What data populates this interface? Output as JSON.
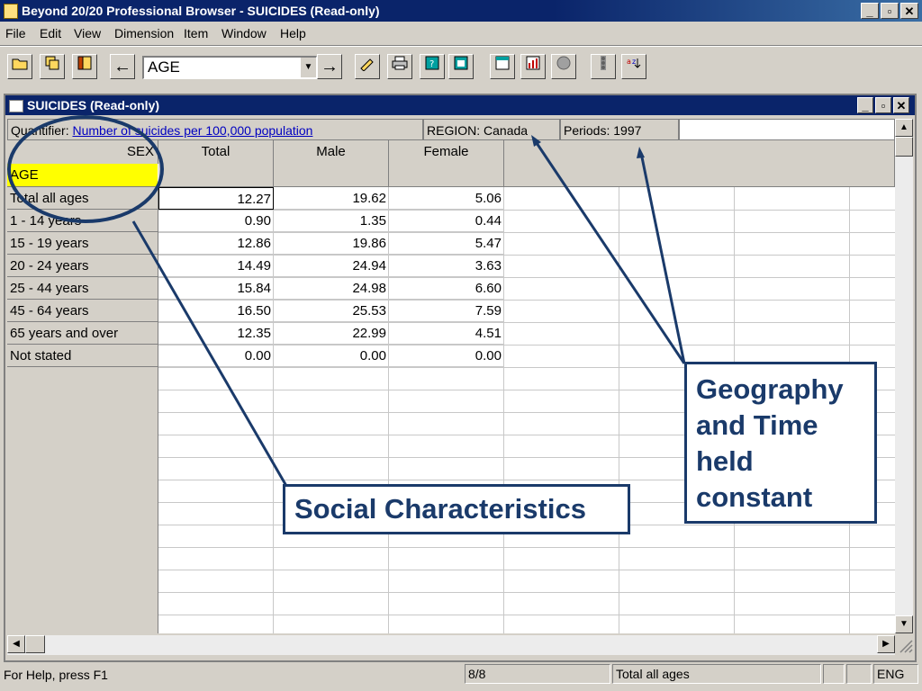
{
  "window": {
    "title": "Beyond 20/20 Professional Browser - SUICIDES (Read-only)",
    "min_glyph": "_",
    "max_glyph": "▫",
    "close_glyph": "✕"
  },
  "menu": [
    "File",
    "Edit",
    "View",
    "Dimension",
    "Item",
    "Window",
    "Help"
  ],
  "toolbar": {
    "back_glyph": "←",
    "forward_glyph": "→",
    "dimension_value": "AGE",
    "dropdown_glyph": "▼",
    "icons": [
      "open-folder-icon",
      "copy-icon",
      "book-icon",
      "pencil-icon",
      "print-icon",
      "help-book-icon",
      "report-icon",
      "table-icon",
      "chart-icon",
      "globe-icon",
      "traffic-light-icon",
      "sort-icon"
    ]
  },
  "document": {
    "title": "SUICIDES (Read-only)",
    "quantifier_label": "Quantifier:",
    "quantifier_value": "Number of suicides per 100,000 population",
    "region": "REGION: Canada",
    "periods": "Periods: 1997"
  },
  "grid": {
    "col_dimension": "SEX",
    "row_dimension": "AGE",
    "columns": [
      "Total",
      "Male",
      "Female"
    ],
    "rows": [
      {
        "label": "Total all ages",
        "values": [
          "12.27",
          "19.62",
          "5.06"
        ]
      },
      {
        "label": "1 - 14 years",
        "values": [
          "0.90",
          "1.35",
          "0.44"
        ]
      },
      {
        "label": "15 - 19 years",
        "values": [
          "12.86",
          "19.86",
          "5.47"
        ]
      },
      {
        "label": "20 - 24 years",
        "values": [
          "14.49",
          "24.94",
          "3.63"
        ]
      },
      {
        "label": "25 - 44 years",
        "values": [
          "15.84",
          "24.98",
          "6.60"
        ]
      },
      {
        "label": "45 - 64 years",
        "values": [
          "16.50",
          "25.53",
          "7.59"
        ]
      },
      {
        "label": "65 years and over",
        "values": [
          "12.35",
          "22.99",
          "4.51"
        ]
      },
      {
        "label": "Not stated",
        "values": [
          "0.00",
          "0.00",
          "0.00"
        ]
      }
    ]
  },
  "status": {
    "help": "For Help, press F1",
    "position": "8/8",
    "current_item": "Total all ages",
    "lang": "ENG"
  },
  "annotations": {
    "social": "Social Characteristics",
    "geo_time": "Geography and Time held constant"
  },
  "colors": {
    "title_bar": "#0a246a",
    "highlight_yellow": "#ffff00",
    "annotation": "#1a3a6a",
    "link": "#0000c0"
  }
}
